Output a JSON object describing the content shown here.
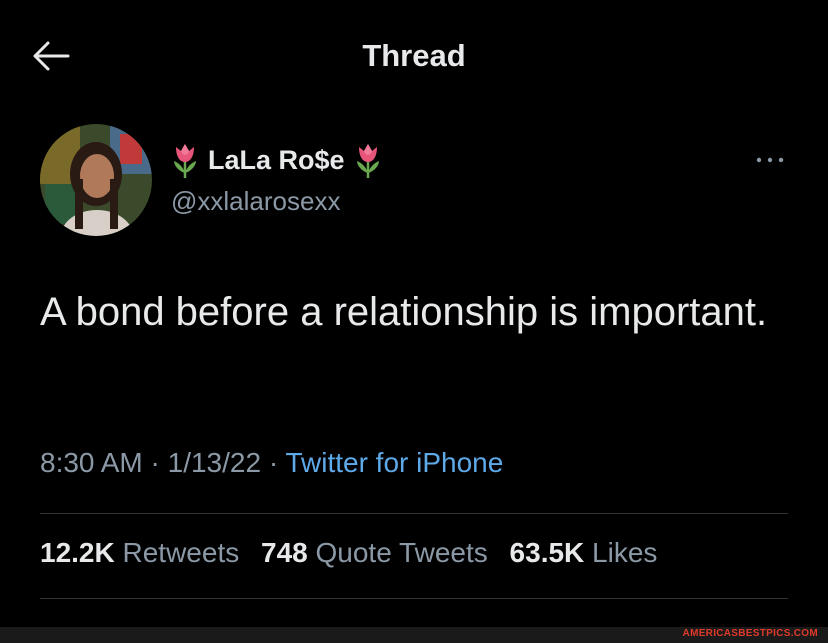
{
  "header": {
    "title": "Thread"
  },
  "author": {
    "display_name": "LaLa Ro$e",
    "handle": "@xxlalarosexx",
    "name_emoji": "tulip-icon"
  },
  "tweet": {
    "text": "A bond before a relationship is important.",
    "time": "8:30 AM",
    "sep1": " · ",
    "date": "1/13/22",
    "sep2": " · ",
    "source": "Twitter for iPhone"
  },
  "stats": {
    "retweets_count": "12.2K",
    "retweets_label": "Retweets",
    "quotes_count": "748",
    "quotes_label": "Quote Tweets",
    "likes_count": "63.5K",
    "likes_label": "Likes"
  },
  "watermark": {
    "text": "AMERICASBESTPICS.COM"
  },
  "colors": {
    "background": "#000000",
    "text": "#e7e9ea",
    "secondary": "#8b98a5",
    "link": "#5ea9e8",
    "divider": "#2f3336",
    "watermark": "#e03a2a"
  }
}
